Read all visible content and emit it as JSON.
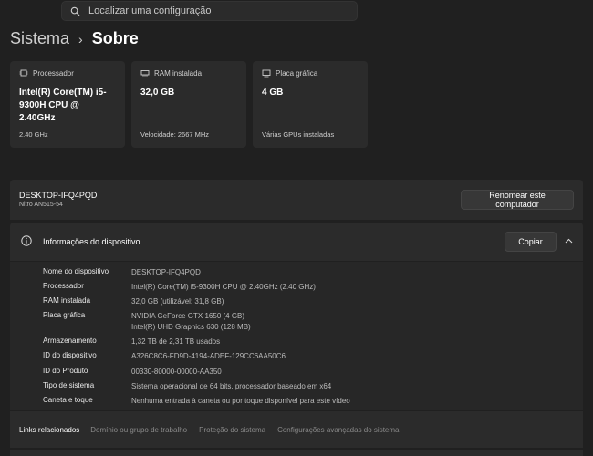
{
  "search": {
    "placeholder": "Localizar uma configuração"
  },
  "breadcrumb": {
    "parent": "Sistema",
    "separator": "›",
    "current": "Sobre"
  },
  "cards": [
    {
      "label": "Processador",
      "value": "Intel(R) Core(TM) i5-9300H CPU @ 2.40GHz",
      "sub": "2.40 GHz",
      "icon": "processor-icon"
    },
    {
      "label": "RAM instalada",
      "value": "32,0 GB",
      "sub": "Velocidade: 2667 MHz",
      "icon": "ram-icon"
    },
    {
      "label": "Placa gráfica",
      "value": "4 GB",
      "sub": "Várias GPUs instaladas",
      "icon": "graphics-card-icon"
    }
  ],
  "device": {
    "name": "DESKTOP-IFQ4PQD",
    "model": "Nitro AN515-54",
    "rename_label": "Renomear este computador"
  },
  "info": {
    "title": "Informações do dispositivo",
    "copy_label": "Copiar",
    "rows": [
      {
        "key": "Nome do dispositivo",
        "value": "DESKTOP-IFQ4PQD"
      },
      {
        "key": "Processador",
        "value": "Intel(R) Core(TM) i5-9300H CPU @ 2.40GHz (2.40 GHz)"
      },
      {
        "key": "RAM instalada",
        "value": "32,0 GB (utilizável: 31,8 GB)"
      },
      {
        "key": "Placa gráfica",
        "value": "NVIDIA GeForce GTX 1650 (4 GB)",
        "value2": "Intel(R) UHD Graphics 630 (128 MB)"
      },
      {
        "key": "Armazenamento",
        "value": "1,32 TB de 2,31 TB usados"
      },
      {
        "key": "ID do dispositivo",
        "value": "A326C8C6-FD9D-4194-ADEF-129CC6AA50C6"
      },
      {
        "key": "ID do Produto",
        "value": "00330-80000-00000-AA350"
      },
      {
        "key": "Tipo de sistema",
        "value": "Sistema operacional de 64 bits, processador baseado em x64"
      },
      {
        "key": "Caneta e toque",
        "value": "Nenhuma entrada à caneta ou por toque disponível para este vídeo"
      }
    ]
  },
  "related": {
    "label": "Links relacionados",
    "links": [
      "Domínio ou grupo de trabalho",
      "Proteção do sistema",
      "Configurações avançadas do sistema"
    ]
  }
}
